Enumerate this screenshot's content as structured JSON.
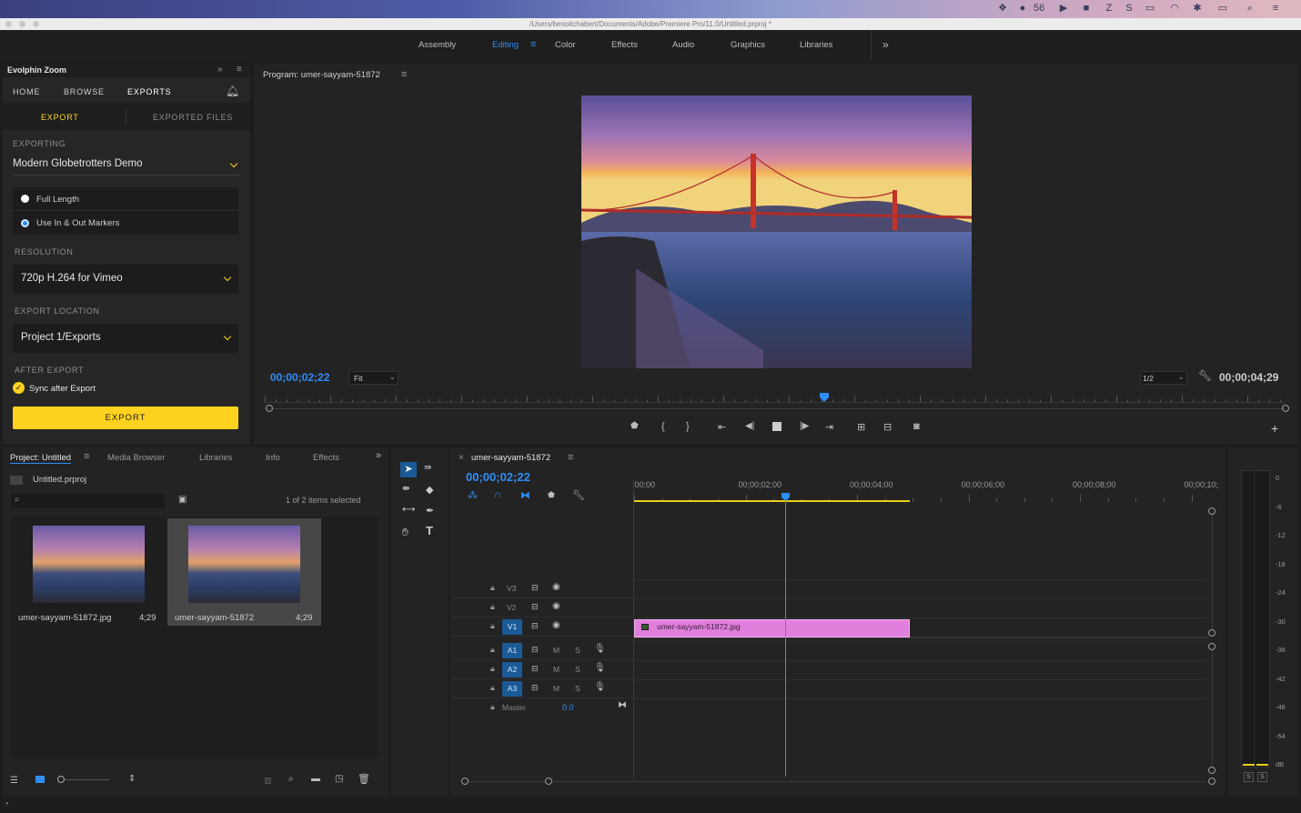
{
  "titlebar": {
    "path": "/Users/benoitchabert/Documents/Adobe/Premiere Pro/11.0/Untitled.prproj *"
  },
  "menubar": {
    "badge_count": "56"
  },
  "workspaces": [
    "Assembly",
    "Editing",
    "Color",
    "Effects",
    "Audio",
    "Graphics",
    "Libraries"
  ],
  "workspace_active": "Editing",
  "colors": {
    "accent_blue": "#2f8ef7",
    "accent_yellow": "#ffd21f",
    "clip_pink": "#e07fdc",
    "track_blue": "#1a5a96"
  },
  "evolphin": {
    "title": "Evolphin Zoom",
    "tabs": [
      "HOME",
      "BROWSE",
      "EXPORTS"
    ],
    "active_tab": "EXPORTS",
    "subtabs": [
      "EXPORT",
      "EXPORTED FILES"
    ],
    "exporting_label": "EXPORTING",
    "exporting_value": "Modern Globetrotters Demo",
    "range_options": [
      "Full Length",
      "Use In & Out Markers"
    ],
    "range_selected": "Use In & Out Markers",
    "resolution_label": "RESOLUTION",
    "resolution_value": "720p H.264 for Vimeo",
    "location_label": "EXPORT LOCATION",
    "location_value": "Project 1/Exports",
    "after_label": "AFTER EXPORT",
    "after_option": "Sync after Export",
    "export_button": "EXPORT"
  },
  "program": {
    "title": "Program: umer-sayyam-51872",
    "timecode_current": "00;00;02;22",
    "fit": "Fit",
    "resolution": "1/2",
    "timecode_duration": "00;00;04;29",
    "playhead_fraction": 0.55
  },
  "project": {
    "tabs": [
      "Project: Untitled",
      "Media Browser",
      "Libraries",
      "Info",
      "Effects"
    ],
    "file": "Untitled.prproj",
    "items_status": "1 of 2 items selected",
    "items": [
      {
        "name": "umer-sayyam-51872.jpg",
        "duration": "4;29"
      },
      {
        "name": "umer-sayyam-51872",
        "duration": "4;29"
      }
    ]
  },
  "timeline": {
    "title": "umer-sayyam-51872",
    "timecode": "00;00;02;22",
    "ruler": [
      ";00;00",
      "00;00;02;00",
      "00;00;04;00",
      "00;00;06;00",
      "00;00;08;00",
      "00;00;10;"
    ],
    "video_tracks": [
      "V3",
      "V2",
      "V1"
    ],
    "audio_tracks": [
      "A1",
      "A2",
      "A3"
    ],
    "master_label": "Master",
    "master_value": "0.0",
    "m_label": "M",
    "s_label": "S",
    "clip_name": "umer-sayyam-51872.jpg"
  },
  "meter": {
    "scale": [
      "0",
      "-6",
      "-12",
      "-18",
      "-24",
      "-30",
      "-36",
      "-42",
      "-48",
      "-54",
      "dB"
    ],
    "solo": [
      "S",
      "S"
    ]
  }
}
